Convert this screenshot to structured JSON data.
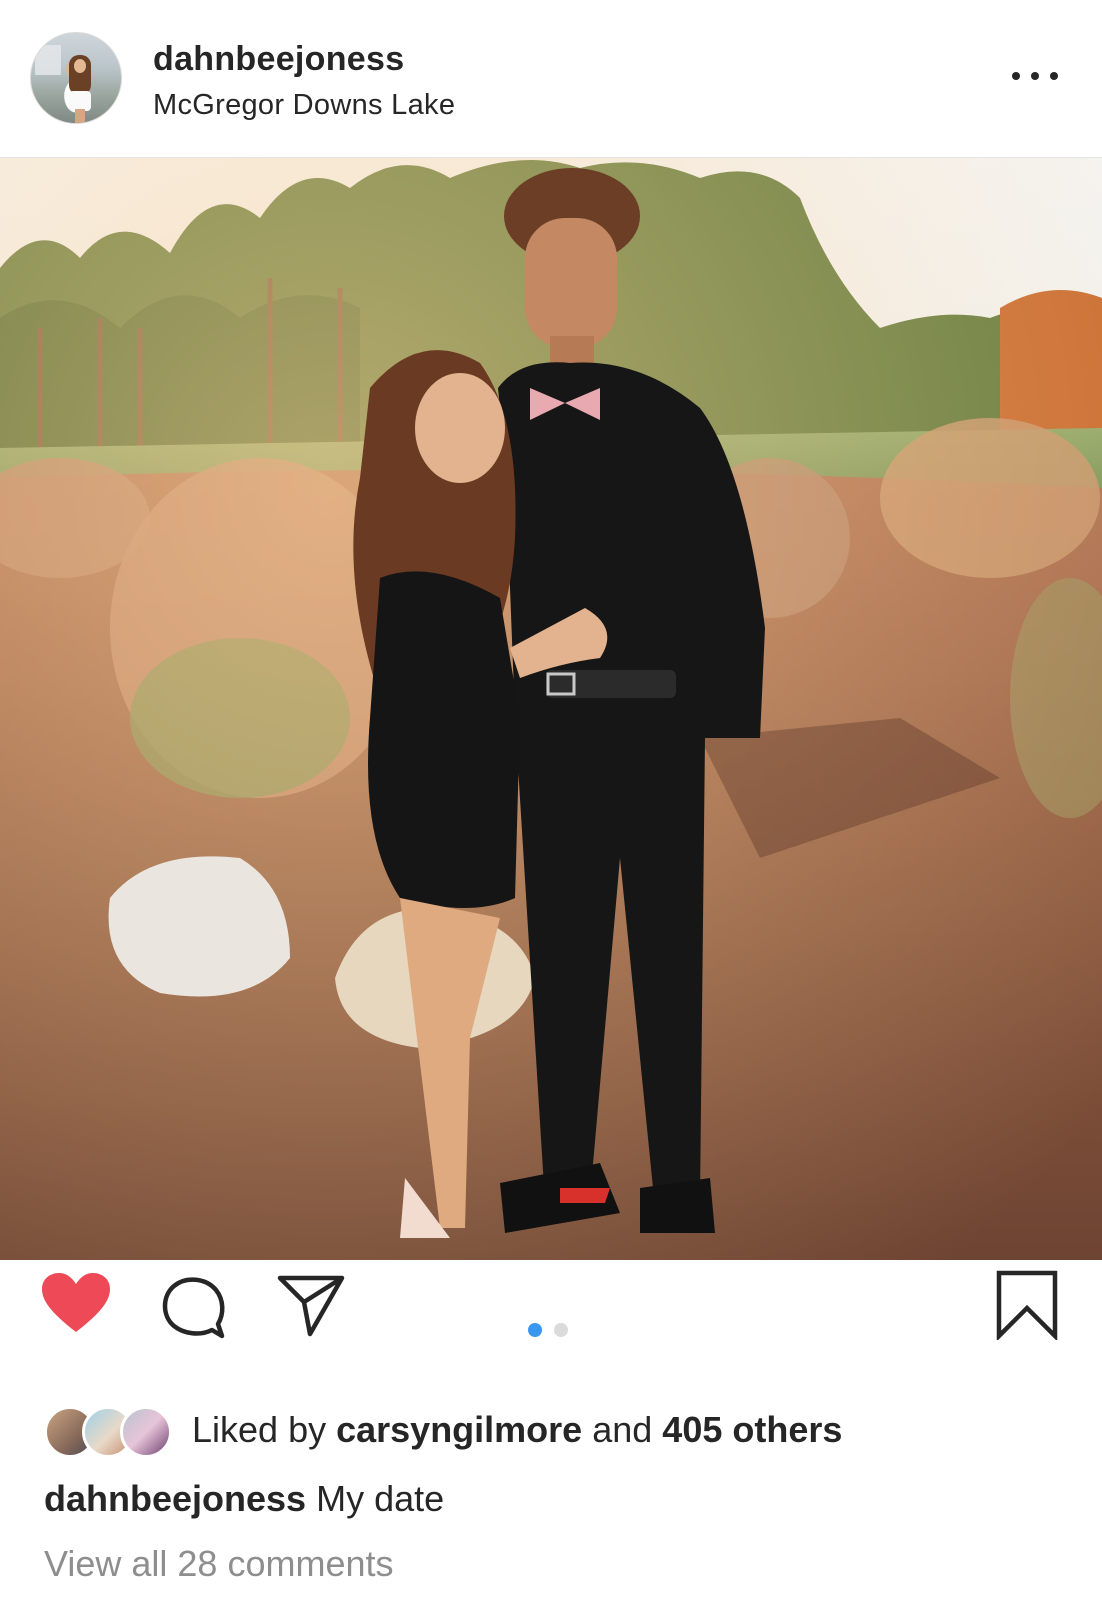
{
  "post": {
    "username": "dahnbeejoness",
    "location": "McGregor Downs Lake",
    "image_description_icon": "photo-of-couple-posing",
    "carousel": {
      "count": 2,
      "active_index": 0
    },
    "liked_by_prefix": "Liked by ",
    "liked_by_user": "carsyngilmore",
    "liked_by_middle": " and ",
    "liked_by_others": "405 others",
    "caption_user": "dahnbeejoness",
    "caption_text": "My date",
    "view_comments": "View all 28 comments"
  },
  "icons": {
    "more": "more-options-icon",
    "like": "heart-icon",
    "comment": "comment-icon",
    "share": "send-icon",
    "save": "bookmark-icon"
  },
  "colors": {
    "like_red": "#ed4956",
    "dot_active": "#3897f0",
    "dot_inactive": "#dbdbdb",
    "text": "#262626",
    "muted": "#8e8e8e"
  }
}
